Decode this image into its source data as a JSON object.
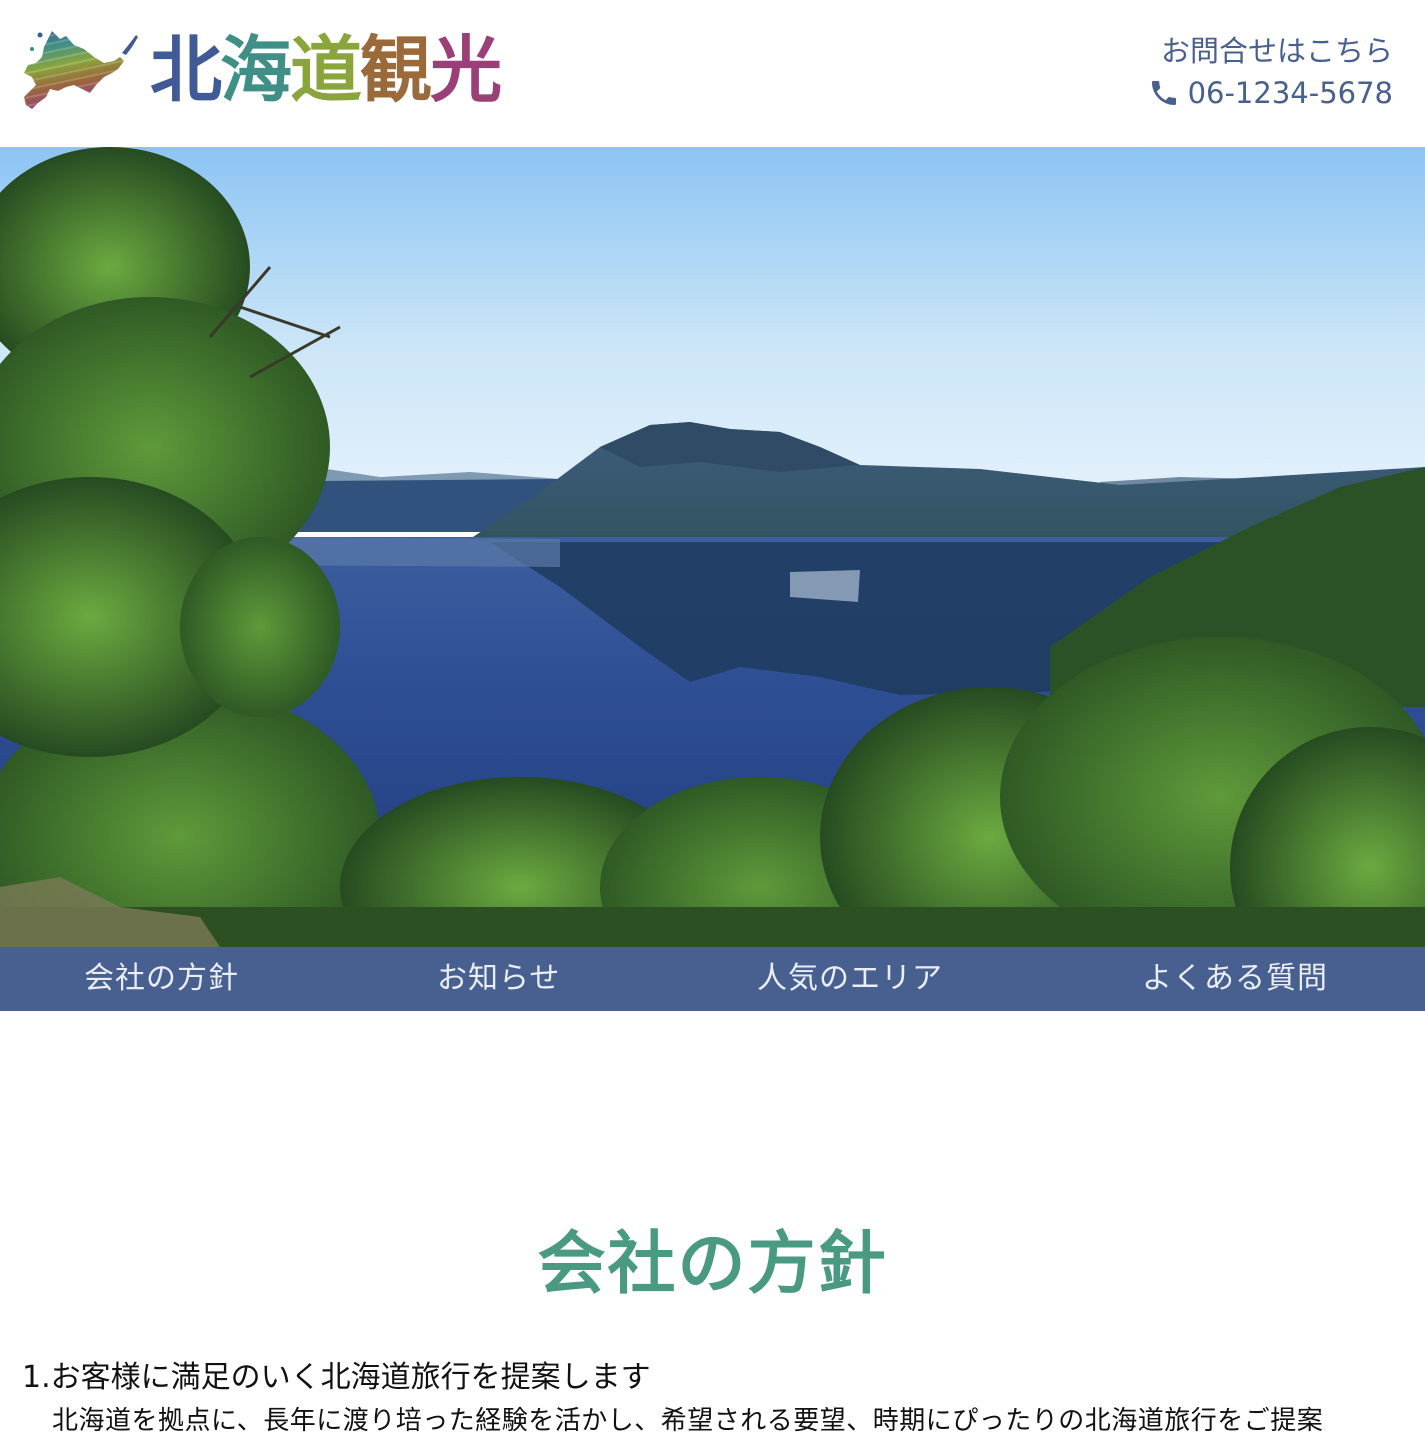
{
  "header": {
    "logo_text": [
      "北",
      "海",
      "道",
      "観",
      "光"
    ],
    "logo_colors": [
      "#3f5a95",
      "#3f8f86",
      "#8aa53c",
      "#9a6a3a",
      "#9b3f78"
    ],
    "contact_label": "お問合せはこちら",
    "phone": "06-1234-5678",
    "contact_color": "#48608f"
  },
  "hero": {
    "image": "lake-landscape"
  },
  "nav": {
    "items": [
      "会社の方針",
      "お知らせ",
      "人気のエリア",
      "よくある質問"
    ],
    "background": "#48608f"
  },
  "main": {
    "section_title": "会社の方針",
    "title_color": "#4a9a83",
    "policy_heading": "1.お客様に満足のいく北海道旅行を提案します",
    "policy_text": "北海道を拠点に、長年に渡り培った経験を活かし、希望される要望、時期にぴったりの北海道旅行をご提案"
  }
}
